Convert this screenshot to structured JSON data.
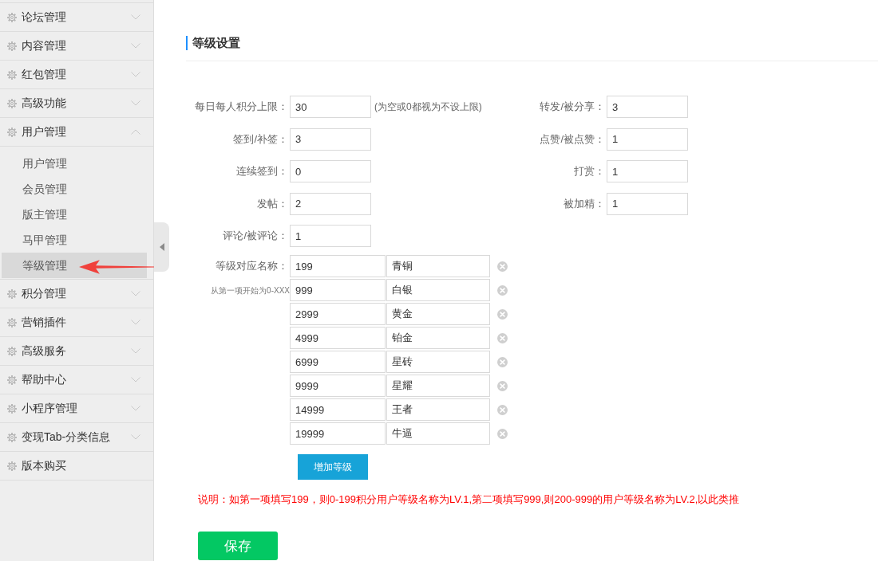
{
  "sidebar": {
    "items": [
      {
        "label": "论坛管理",
        "kind": "group",
        "expanded": false
      },
      {
        "label": "内容管理",
        "kind": "group",
        "expanded": false
      },
      {
        "label": "红包管理",
        "kind": "group",
        "expanded": false
      },
      {
        "label": "高级功能",
        "kind": "group",
        "expanded": false
      },
      {
        "label": "用户管理",
        "kind": "group",
        "expanded": true,
        "children": [
          {
            "label": "用户管理",
            "selected": false
          },
          {
            "label": "会员管理",
            "selected": false
          },
          {
            "label": "版主管理",
            "selected": false
          },
          {
            "label": "马甲管理",
            "selected": false
          },
          {
            "label": "等级管理",
            "selected": true
          }
        ]
      },
      {
        "label": "积分管理",
        "kind": "group",
        "expanded": false
      },
      {
        "label": "营销插件",
        "kind": "group",
        "expanded": false
      },
      {
        "label": "高级服务",
        "kind": "group",
        "expanded": false
      },
      {
        "label": "帮助中心",
        "kind": "group",
        "expanded": false
      },
      {
        "label": "小程序管理",
        "kind": "group",
        "expanded": false
      },
      {
        "label": "变现Tab-分类信息",
        "kind": "group",
        "expanded": false
      },
      {
        "label": "版本购买",
        "kind": "link"
      }
    ]
  },
  "page": {
    "title": "等级设置"
  },
  "form": {
    "left": [
      {
        "label": "每日每人积分上限：",
        "value": "30",
        "hint": "(为空或0都视为不设上限)"
      },
      {
        "label": "签到/补签：",
        "value": "3"
      },
      {
        "label": "连续签到：",
        "value": "0"
      },
      {
        "label": "发帖：",
        "value": "2"
      },
      {
        "label": "评论/被评论：",
        "value": "1"
      }
    ],
    "right": [
      {
        "label": "转发/被分享：",
        "value": "3"
      },
      {
        "label": "点赞/被点赞：",
        "value": "1"
      },
      {
        "label": "打赏：",
        "value": "1"
      },
      {
        "label": "被加精：",
        "value": "1"
      }
    ]
  },
  "levels": {
    "label": "等级对应名称：",
    "note": "从第一项开始为0-XXX",
    "rows": [
      {
        "points": "199",
        "name": "青铜"
      },
      {
        "points": "999",
        "name": "白银"
      },
      {
        "points": "2999",
        "name": "黄金"
      },
      {
        "points": "4999",
        "name": "铂金"
      },
      {
        "points": "6999",
        "name": "星砖"
      },
      {
        "points": "9999",
        "name": "星耀"
      },
      {
        "points": "14999",
        "name": "王者"
      },
      {
        "points": "19999",
        "name": "牛逼"
      }
    ],
    "add_button": "增加等级"
  },
  "explanation": "说明：如第一项填写199，则0-199积分用户等级名称为LV.1,第二项填写999,则200-999的用户等级名称为LV.2,以此类推",
  "save_button": "保存"
}
